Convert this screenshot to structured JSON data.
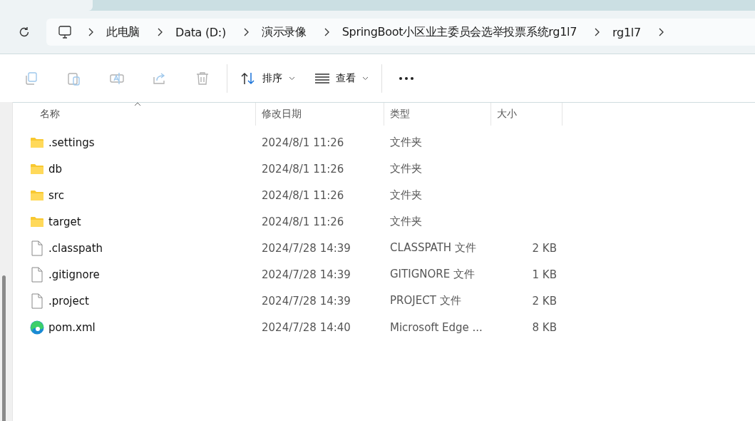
{
  "breadcrumb": [
    "此电脑",
    "Data (D:)",
    "演示录像",
    "SpringBoot小区业主委员会选举投票系统rg1l7",
    "rg1l7"
  ],
  "toolbar": {
    "actions": [
      {
        "kind": "copy",
        "disabled": true
      },
      {
        "kind": "paste",
        "disabled": true
      },
      {
        "kind": "rename",
        "disabled": true
      },
      {
        "kind": "share",
        "disabled": true
      },
      {
        "kind": "delete",
        "disabled": true
      }
    ],
    "sort": "排序",
    "view": "查看"
  },
  "columns": [
    {
      "label": "名称",
      "sorted": true
    },
    {
      "label": "修改日期",
      "sorted": false
    },
    {
      "label": "类型",
      "sorted": false
    },
    {
      "label": "大小",
      "sorted": false
    }
  ],
  "rows": [
    {
      "kind": "folder",
      "name": ".settings",
      "date": "2024/8/1 11:26",
      "type": "文件夹"
    },
    {
      "kind": "folder",
      "name": "db",
      "date": "2024/8/1 11:26",
      "type": "文件夹"
    },
    {
      "kind": "folder",
      "name": "src",
      "date": "2024/8/1 11:26",
      "type": "文件夹"
    },
    {
      "kind": "folder",
      "name": "target",
      "date": "2024/8/1 11:26",
      "type": "文件夹"
    },
    {
      "kind": "file",
      "name": ".classpath",
      "date": "2024/7/28 14:39",
      "type": "CLASSPATH 文件",
      "size": "2 KB"
    },
    {
      "kind": "file",
      "name": ".gitignore",
      "date": "2024/7/28 14:39",
      "type": "GITIGNORE 文件",
      "size": "1 KB"
    },
    {
      "kind": "file",
      "name": ".project",
      "date": "2024/7/28 14:39",
      "type": "PROJECT 文件",
      "size": "2 KB"
    },
    {
      "kind": "edge",
      "name": "pom.xml",
      "date": "2024/7/28 14:40",
      "type": "Microsoft Edge ...",
      "size": "8 KB"
    }
  ]
}
